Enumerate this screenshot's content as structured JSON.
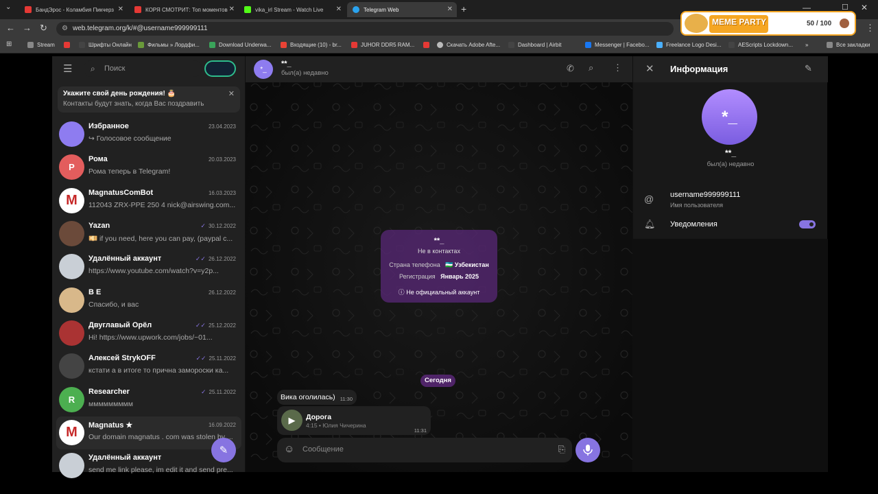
{
  "tabs": [
    {
      "title": "БандЭрос - Коламбия Пикчерз",
      "fav": "#e53935"
    },
    {
      "title": "КОРЯ СМОТРИТ: Топ моментов",
      "fav": "#e53935"
    },
    {
      "title": "vika_irl Stream - Watch Live",
      "fav": "#53fc18"
    },
    {
      "title": "Telegram Web",
      "fav": "#2aa3ef"
    }
  ],
  "url": "web.telegram.org/k/#@username999999111",
  "bookmarks": [
    {
      "label": "Stream",
      "color": "#888"
    },
    {
      "label": "Шрифты Онлайн",
      "color": "#e53935"
    },
    {
      "label": "Фильмы » Лордфи...",
      "color": "#6a9a3a"
    },
    {
      "label": "Download Underwa...",
      "color": "#3aa35a"
    },
    {
      "label": "Входящие (10) - br...",
      "color": "#ea4335"
    },
    {
      "label": "JUHOR DDR5 RAM...",
      "color": "#e53935"
    },
    {
      "label": "",
      "color": "#e53935"
    },
    {
      "label": "Скачать Adobe Afte...",
      "color": "#bbb"
    },
    {
      "label": "Dashboard | Airbit",
      "color": "#444"
    },
    {
      "label": "Messenger | Facebo...",
      "color": "#1877f2"
    },
    {
      "label": "Freelance Logo Desi...",
      "color": "#4ab0ff"
    },
    {
      "label": "AEScripts Lockdown...",
      "color": "#444"
    }
  ],
  "all_bookmarks": "Все закладки",
  "meme": {
    "title": "MEME PARTY",
    "score": "50 / 100"
  },
  "left": {
    "search_placeholder": "Поиск",
    "banner_title": "Укажите свой день рождения! 🎂",
    "banner_sub": "Контакты будут знать, когда Вас поздравить",
    "chats": [
      {
        "name": "Избранное",
        "date": "23.04.2023",
        "preview": "↪ Голосовое сообщение",
        "avatar": "",
        "color": "#8e7cf0",
        "check": ""
      },
      {
        "name": "Рома",
        "date": "20.03.2023",
        "preview": "Рома теперь в Telegram!",
        "avatar": "Р",
        "color": "#e35d5d",
        "check": ""
      },
      {
        "name": "MagnatusComBot",
        "date": "16.03.2023",
        "preview": "112043 ZRX-PPE 250 4 nick@airswing.com...",
        "avatar": "M",
        "color": "#ffffff",
        "check": ""
      },
      {
        "name": "Yazan",
        "date": "30.12.2022",
        "preview": "💴 if you need, here you can pay, (paypal c...",
        "avatar": "",
        "color": "#6b4a3a",
        "check": "✓"
      },
      {
        "name": "Удалённый аккаунт",
        "date": "26.12.2022",
        "preview": "https://www.youtube.com/watch?v=y2p...",
        "avatar": "",
        "color": "#c9cfd6",
        "check": "✓✓"
      },
      {
        "name": "B E",
        "date": "26.12.2022",
        "preview": "Спасибо, и вас",
        "avatar": "",
        "color": "#d8b88a",
        "check": ""
      },
      {
        "name": "Двуглавый Орёл",
        "date": "25.12.2022",
        "preview": "Hi! https://www.upwork.com/jobs/~01...",
        "avatar": "",
        "color": "#a33",
        "check": "✓✓"
      },
      {
        "name": "Алексей StrykOFF",
        "date": "25.11.2022",
        "preview": "кстати а в итоге то прична замороски ка...",
        "avatar": "",
        "color": "#444",
        "check": "✓✓"
      },
      {
        "name": "Researcher",
        "date": "25.11.2022",
        "preview": "ммммммммм",
        "avatar": "R",
        "color": "#4caf50",
        "check": "✓"
      },
      {
        "name": "Magnatus ★",
        "date": "16.09.2022",
        "preview": "Our domain magnatus . com was stolen by ...",
        "avatar": "M",
        "color": "#ffffff",
        "check": ""
      },
      {
        "name": "Удалённый аккаунт",
        "date": "",
        "preview": "send me link please, im edit it and send pre...",
        "avatar": "",
        "color": "#c9cfd6",
        "check": "✓"
      }
    ]
  },
  "chat": {
    "name": "**_",
    "status": "был(а) недавно",
    "card_name": "**_",
    "card_sub": "Не в контактах",
    "card_phone_label": "Страна телефона",
    "card_phone_value": "🇺🇿 Узбекистан",
    "card_reg_label": "Регистрация",
    "card_reg_value": "Январь 2025",
    "card_note": "Не официальный аккаунт",
    "date_pill": "Сегодня",
    "msg1_text": "Вика оголилась)",
    "msg1_time": "11:30",
    "audio_title": "Дорога",
    "audio_sub": "4:15 • Юлия Чичерина",
    "audio_time": "11:31",
    "composer_placeholder": "Сообщение"
  },
  "info": {
    "title": "Информация",
    "avatar": "*_",
    "name": "**_",
    "status": "был(а) недавно",
    "username": "username999999111",
    "username_label": "Имя пользователя",
    "notifications": "Уведомления",
    "notifications_on": true
  },
  "colors": {
    "accent": "#8774e1"
  }
}
